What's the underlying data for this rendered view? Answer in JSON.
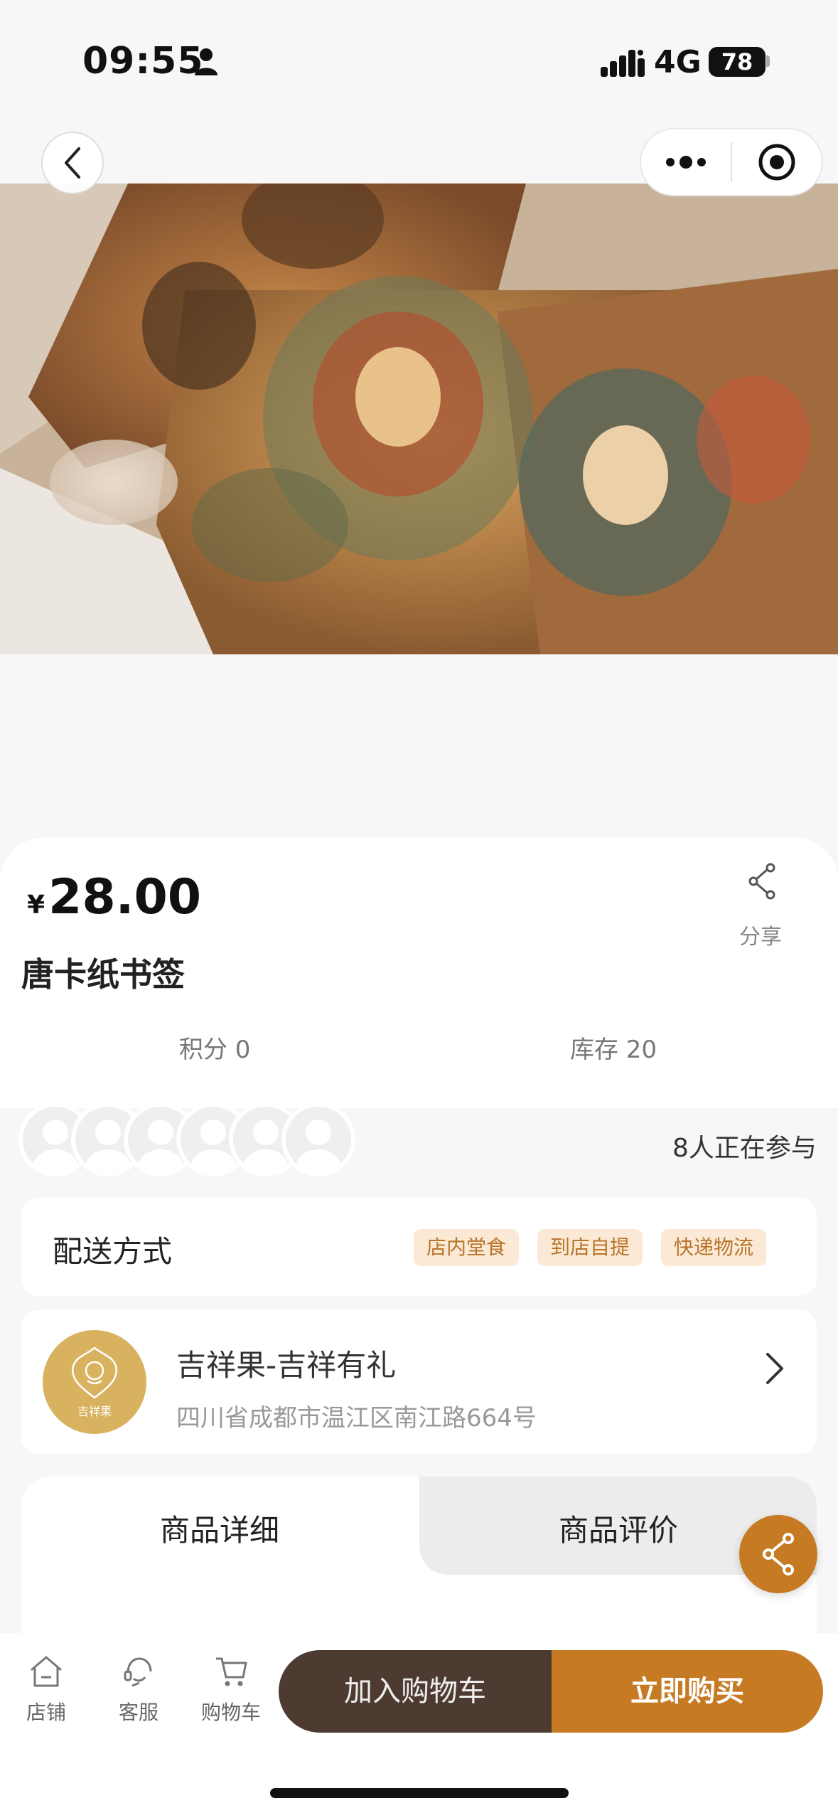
{
  "status_bar": {
    "time": "09:55",
    "network": "4G",
    "battery": "78"
  },
  "product": {
    "currency_symbol": "¥",
    "price": "28.00",
    "title": "唐卡纸书签",
    "share_label": "分享",
    "points": "积分 0",
    "stock": "库存 20",
    "participants": "8人正在参与"
  },
  "delivery": {
    "label": "配送方式",
    "tags": [
      "店内堂食",
      "到店自提",
      "快递物流"
    ]
  },
  "store": {
    "name": "吉祥果-吉祥有礼",
    "address": "四川省成都市温江区南江路664号",
    "logo_text": "吉祥果"
  },
  "tabs": {
    "details": "商品详细",
    "reviews": "商品评价"
  },
  "bottom_bar": {
    "shop": "店铺",
    "service": "客服",
    "cart": "购物车",
    "add_to_cart": "加入购物车",
    "buy_now": "立即购买"
  },
  "colors": {
    "accent": "#c67a23",
    "dark_button": "#4d3b31",
    "tag_bg": "#fbe9d6",
    "tag_text": "#b8752a"
  }
}
